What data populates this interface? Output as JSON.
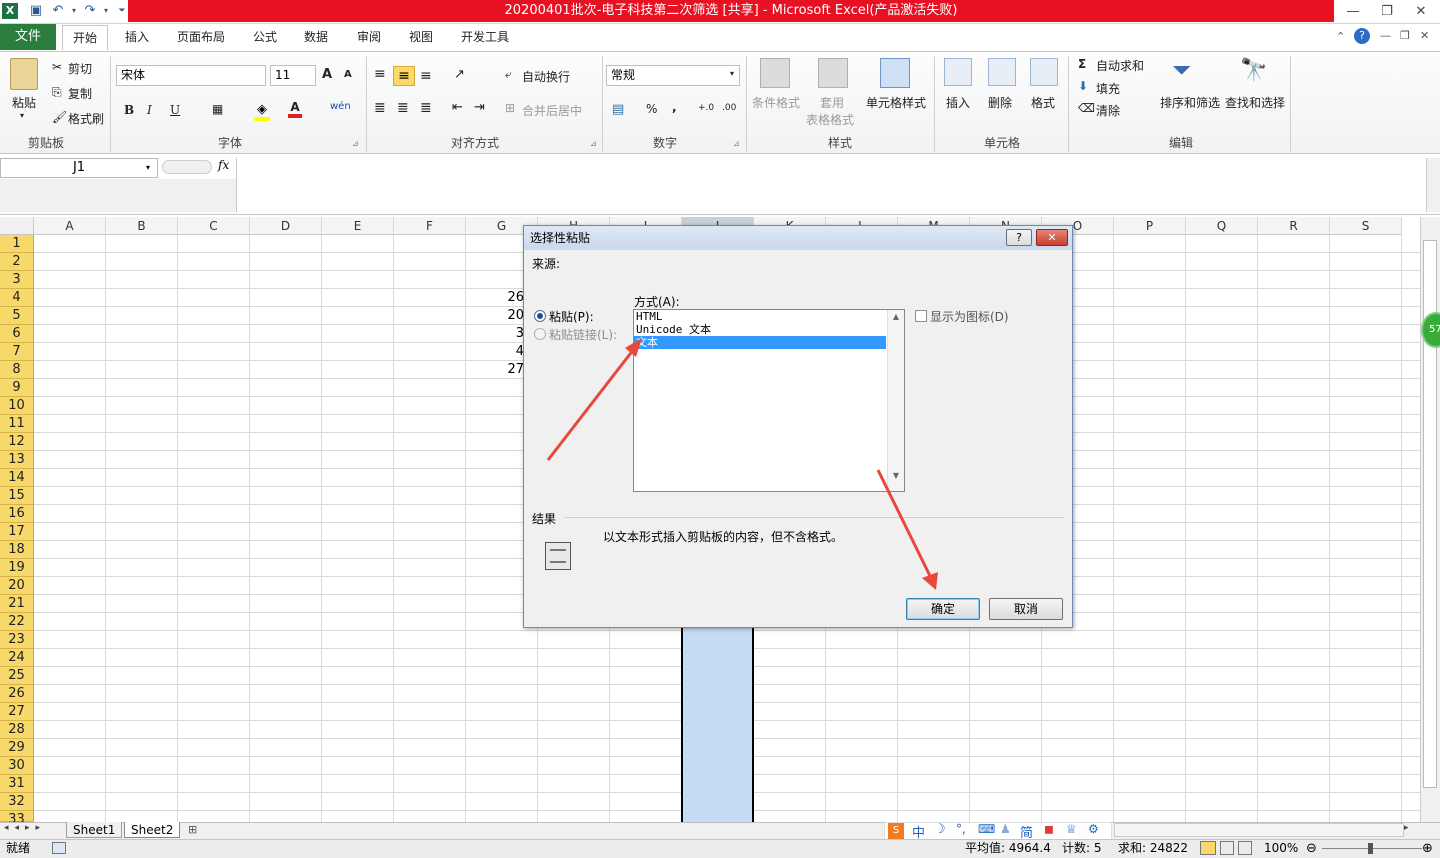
{
  "window": {
    "title": "20200401批次-电子科技第二次筛选  [共享]  -  Microsoft Excel(产品激活失败)",
    "controls": [
      "—",
      "❐",
      "✕"
    ]
  },
  "ribbon_tabs": [
    "文件",
    "开始",
    "插入",
    "页面布局",
    "公式",
    "数据",
    "审阅",
    "视图",
    "开发工具"
  ],
  "clipboard": {
    "paste": "粘贴",
    "cut": "剪切",
    "copy": "复制",
    "format_painter": "格式刷",
    "label": "剪贴板"
  },
  "font": {
    "name": "宋体",
    "size": "11",
    "label": "字体",
    "bold": "B",
    "italic": "I",
    "underline": "U",
    "grow": "A",
    "shrink": "A",
    "color_a": "A",
    "wen": "wén"
  },
  "alignment": {
    "wrap": "自动换行",
    "merge": "合并后居中",
    "label": "对齐方式"
  },
  "number": {
    "format": "常规",
    "label": "数字",
    "percent": "%",
    "comma": ","
  },
  "styles": {
    "conditional": "条件格式",
    "table1": "套用",
    "table2": "表格格式",
    "cell": "单元格样式",
    "label": "样式"
  },
  "cells": {
    "insert": "插入",
    "delete": "删除",
    "format": "格式",
    "label": "单元格"
  },
  "editing": {
    "autosum": "自动求和",
    "fill": "填充",
    "clear": "清除",
    "sort": "排序和筛选",
    "find": "查找和选择",
    "label": "编辑"
  },
  "formula_bar": {
    "cell_ref": "J1",
    "fx": "fx",
    "value": ""
  },
  "columns": [
    "A",
    "B",
    "C",
    "D",
    "E",
    "F",
    "G",
    "H",
    "I",
    "J",
    "K",
    "L",
    "M",
    "N",
    "O",
    "P",
    "Q",
    "R",
    "S"
  ],
  "rows": [
    "1",
    "2",
    "3",
    "4",
    "5",
    "6",
    "7",
    "8",
    "9",
    "10",
    "11",
    "12",
    "13",
    "14",
    "15",
    "16",
    "17",
    "18",
    "19",
    "20",
    "21",
    "22",
    "23",
    "24",
    "25",
    "26",
    "27",
    "28",
    "29",
    "30",
    "31",
    "32",
    "33"
  ],
  "cells_visible": [
    {
      "row": "4",
      "value": "26"
    },
    {
      "row": "5",
      "value": "20"
    },
    {
      "row": "6",
      "value": "3"
    },
    {
      "row": "7",
      "value": "4"
    },
    {
      "row": "8",
      "value": "27"
    }
  ],
  "dialog": {
    "title": "选择性粘贴",
    "help": "?",
    "close": "✕",
    "source_label": "来源:",
    "method_label": "方式(A):",
    "paste_radio": "粘贴(P):",
    "paste_link_radio": "粘贴链接(L):",
    "options": [
      "HTML",
      "Unicode 文本",
      "文本"
    ],
    "selected_index": 2,
    "display_as_icon": "显示为图标(D)",
    "result_label": "结果",
    "result_text": "以文本形式插入剪贴板的内容，但不含格式。",
    "ok": "确定",
    "cancel": "取消"
  },
  "sheets": [
    "Sheet1",
    "Sheet2"
  ],
  "active_sheet": "Sheet2",
  "status": {
    "ready": "就绪",
    "average": "平均值: 4964.4",
    "count": "计数: 5",
    "sum": "求和: 24822",
    "zoom": "100%"
  },
  "ime_bar": [
    "中",
    "简"
  ],
  "side_badge": "57",
  "colors": {
    "title_red": "#e81123",
    "file_tab": "#2a7d3c",
    "row_header": "#f7d86b",
    "selection": "#c5dcf5",
    "arrow": "#e8473b"
  }
}
